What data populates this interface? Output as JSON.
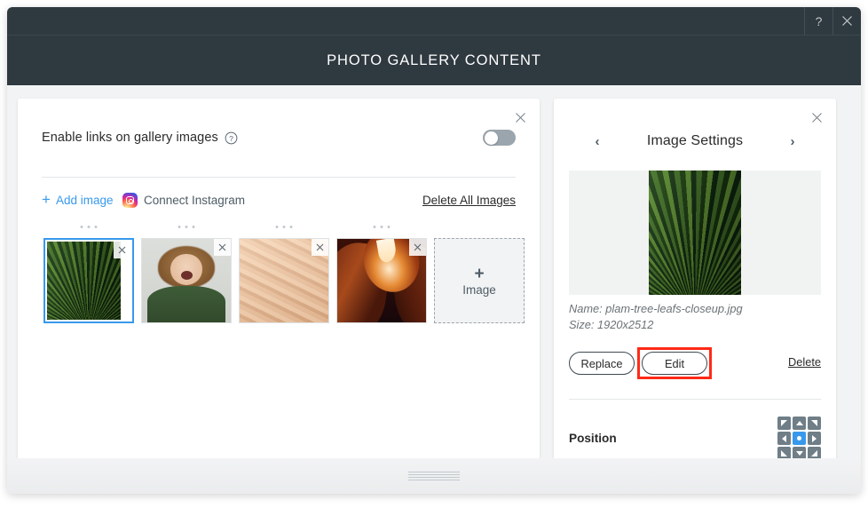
{
  "window": {
    "help_label": "?",
    "close_label": "✕",
    "header_title": "PHOTO GALLERY CONTENT"
  },
  "left_panel": {
    "close_label": "✕",
    "link_setting": {
      "label": "Enable links on gallery images",
      "help_icon": "question-mark-circle-icon",
      "toggle_state": "off"
    },
    "actions": {
      "add_image_plus": "+",
      "add_image_label": "Add image",
      "connect_instagram_label": "Connect Instagram",
      "instagram_icon": "instagram-icon",
      "delete_all_label": "Delete All Images"
    },
    "thumbnails": [
      {
        "name": "plam-tree-leafs-closeup.jpg",
        "art": "palm",
        "selected": true,
        "remove_label": "✕"
      },
      {
        "name": "laughing-woman.jpg",
        "art": "woman",
        "selected": false,
        "remove_label": "✕"
      },
      {
        "name": "sand-dunes.jpg",
        "art": "dunes",
        "selected": false,
        "remove_label": "✕"
      },
      {
        "name": "antelope-canyon.jpg",
        "art": "canyon",
        "selected": false,
        "remove_label": "✕"
      }
    ],
    "add_tile": {
      "plus": "+",
      "label": "Image"
    }
  },
  "right_panel": {
    "close_label": "✕",
    "title": "Image Settings",
    "prev_label": "‹",
    "next_label": "›",
    "preview_art": "palm",
    "meta": {
      "name_line": "Name: plam-tree-leafs-closeup.jpg",
      "size_line": "Size: 1920x2512"
    },
    "buttons": {
      "replace_label": "Replace",
      "edit_label": "Edit",
      "delete_label": "Delete",
      "highlighted": "edit"
    },
    "position": {
      "label": "Position",
      "cells": [
        {
          "dir": "up-left",
          "icon": "arrow-up-left-icon",
          "active": false
        },
        {
          "dir": "up",
          "icon": "arrow-up-icon",
          "active": false
        },
        {
          "dir": "up-right",
          "icon": "arrow-up-right-icon",
          "active": false
        },
        {
          "dir": "left",
          "icon": "arrow-left-icon",
          "active": false
        },
        {
          "dir": "center",
          "icon": "center-dot-icon",
          "active": true
        },
        {
          "dir": "right",
          "icon": "arrow-right-icon",
          "active": false
        },
        {
          "dir": "down-left",
          "icon": "arrow-down-left-icon",
          "active": false
        },
        {
          "dir": "down",
          "icon": "arrow-down-icon",
          "active": false
        },
        {
          "dir": "down-right",
          "icon": "arrow-down-right-icon",
          "active": false
        }
      ]
    }
  },
  "colors": {
    "header_bg": "#2f3940",
    "accent_blue": "#3899ec",
    "page_bg": "#f2f3f4",
    "highlight_red": "#ff2a17",
    "position_cell": "#6f7e87"
  }
}
